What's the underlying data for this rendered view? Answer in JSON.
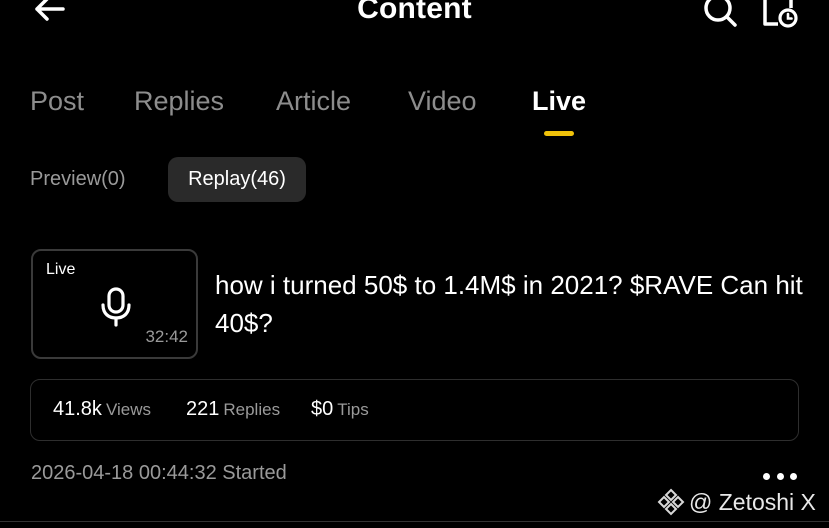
{
  "header": {
    "title": "Content",
    "back_icon": "arrow-left-icon",
    "search_icon": "search-icon",
    "calendar_icon": "calendar-clock-icon"
  },
  "tabs": [
    {
      "label": "Post"
    },
    {
      "label": "Replies"
    },
    {
      "label": "Article"
    },
    {
      "label": "Video"
    },
    {
      "label": "Live",
      "active": true
    }
  ],
  "accent_color": "#f0c20a",
  "subtabs": {
    "preview": "Preview(0)",
    "replay": "Replay(46)"
  },
  "live_item": {
    "badge": "Live",
    "mic_icon": "microphone-icon",
    "duration": "32:42",
    "title": "how i turned 50$ to 1.4M$ in 2021? $RAVE Can hit 40$?",
    "stats": {
      "views_value": "41.8k",
      "views_label": "Views",
      "replies_value": "221",
      "replies_label": "Replies",
      "tips_value": "$0",
      "tips_label": "Tips"
    },
    "started": "2026-04-18 00:44:32 Started",
    "more_icon": "more-dots-icon"
  },
  "watermark": {
    "icon": "binance-logo-icon",
    "text": "@ Zetoshi X"
  }
}
